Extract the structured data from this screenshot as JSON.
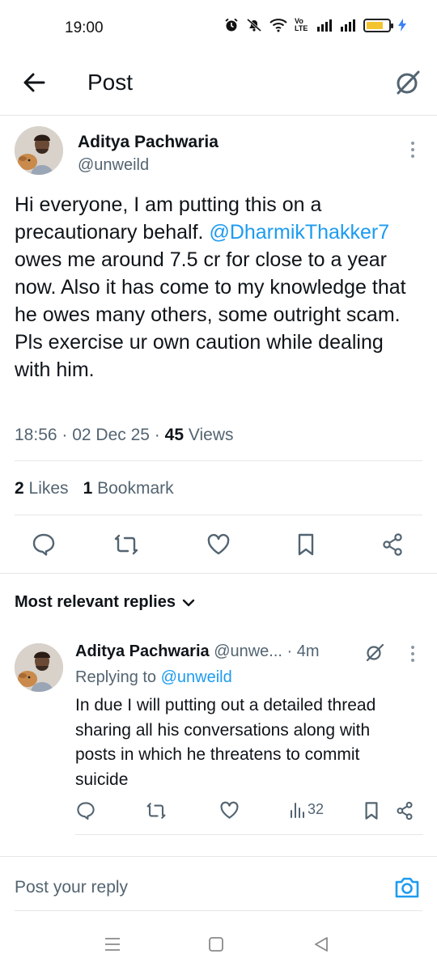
{
  "status_bar": {
    "time": "19:00",
    "network_label": "Vo LTE",
    "battery_percent": 75
  },
  "header": {
    "title": "Post"
  },
  "post": {
    "author_name": "Aditya Pachwaria",
    "author_handle": "@unweild",
    "text_before": "Hi everyone,  I am putting this on a precautionary behalf. ",
    "mention": "@DharmikThakker7",
    "text_after": " owes me around 7.5 cr for close to a year now. Also it has come to my knowledge that he owes many others, some outright scam. Pls exercise ur own caution while dealing with him.",
    "time": "18:56",
    "date": "02 Dec 25",
    "views_count": "45",
    "views_label": "Views",
    "likes_count": "2",
    "likes_label": "Likes",
    "bookmarks_count": "1",
    "bookmarks_label": "Bookmark"
  },
  "replies_sort": {
    "label": "Most relevant replies"
  },
  "reply": {
    "author_name": "Aditya Pachwaria",
    "author_handle": "@unwe...",
    "time": "4m",
    "replying_prefix": "Replying to",
    "replying_handle": "@unweild",
    "text": "In due I will putting out a detailed thread sharing all his conversations along with posts in which he threatens to commit suicide",
    "views_count": "32"
  },
  "compose": {
    "placeholder": "Post your reply"
  },
  "colors": {
    "accent": "#1d9bf0",
    "text": "#0f1419",
    "muted": "#536471",
    "divider": "#e6e6e6"
  }
}
